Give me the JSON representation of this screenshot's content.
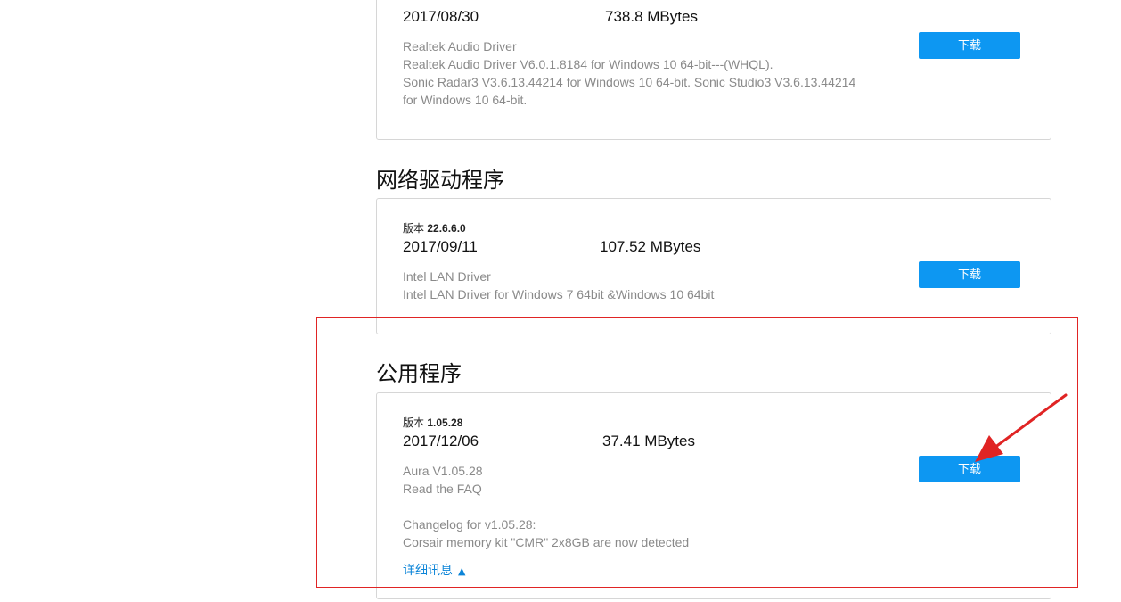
{
  "audio_card": {
    "date": "2017/08/30",
    "size": "738.8 MBytes",
    "desc": [
      "Realtek Audio Driver",
      "Realtek Audio Driver V6.0.1.8184 for Windows 10 64-bit---(WHQL).",
      "Sonic Radar3 V3.6.13.44214 for Windows 10 64-bit. Sonic Studio3 V3.6.13.44214",
      "for Windows 10 64-bit."
    ],
    "download_label": "下载"
  },
  "network_section": {
    "title": "网络驱动程序",
    "version_label": "版本",
    "version": "22.6.6.0",
    "date": "2017/09/11",
    "size": "107.52 MBytes",
    "desc": [
      "Intel LAN Driver",
      "Intel LAN Driver for Windows 7 64bit &Windows 10 64bit"
    ],
    "download_label": "下载"
  },
  "utility_section": {
    "title": "公用程序",
    "version_label": "版本",
    "version": "1.05.28",
    "date": "2017/12/06",
    "size": "37.41 MBytes",
    "desc": [
      "Aura V1.05.28",
      "Read the FAQ"
    ],
    "changelog": [
      "Changelog for v1.05.28:",
      "Corsair memory kit \"CMR\" 2x8GB are now detected"
    ],
    "details_label": "详细讯息",
    "download_label": "下载"
  },
  "annotation": {
    "color": "#e02424",
    "accent_button": "#0d97f2",
    "link_color": "#0d85d8"
  }
}
